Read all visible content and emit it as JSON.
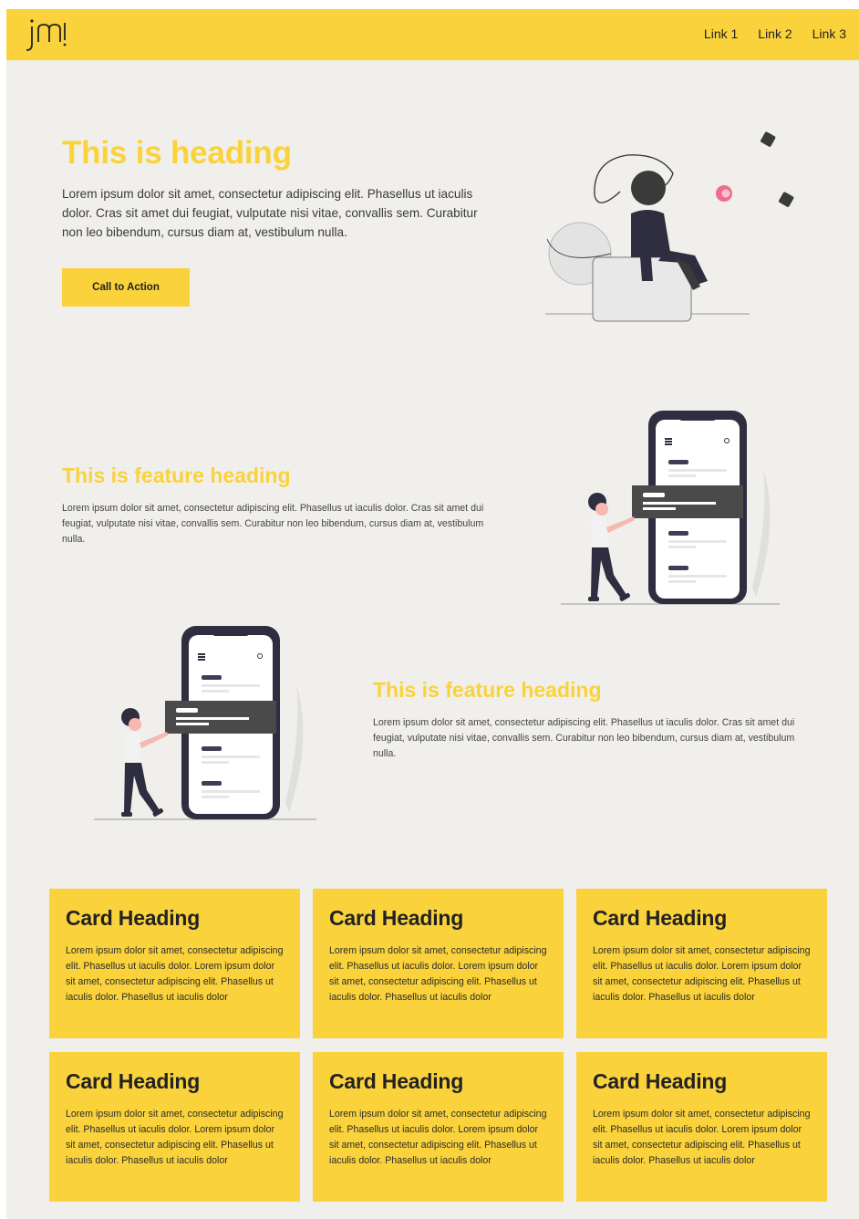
{
  "header": {
    "logo_text": "jm",
    "nav": [
      "Link 1",
      "Link 2",
      "Link 3"
    ]
  },
  "hero": {
    "title": "This is heading",
    "text": "Lorem ipsum dolor sit amet, consectetur adipiscing elit. Phasellus ut iaculis dolor. Cras sit amet dui feugiat, vulputate nisi vitae, convallis sem. Curabitur non leo bibendum, cursus diam at, vestibulum nulla.",
    "cta_label": "Call to Action"
  },
  "features": [
    {
      "title": "This is feature heading",
      "text": "Lorem ipsum dolor sit amet, consectetur adipiscing elit. Phasellus ut iaculis dolor. Cras sit amet dui feugiat, vulputate nisi vitae, convallis sem. Curabitur non leo bibendum, cursus diam at, vestibulum nulla."
    },
    {
      "title": "This is feature heading",
      "text": "Lorem ipsum dolor sit amet, consectetur adipiscing elit. Phasellus ut iaculis dolor. Cras sit amet dui feugiat, vulputate nisi vitae, convallis sem. Curabitur non leo bibendum, cursus diam at, vestibulum nulla."
    }
  ],
  "cards": [
    {
      "heading": "Card Heading",
      "text": "Lorem ipsum dolor sit amet, consectetur adipiscing elit. Phasellus ut iaculis dolor. Lorem ipsum dolor sit amet, consectetur adipiscing elit. Phasellus ut iaculis dolor. Phasellus ut iaculis dolor"
    },
    {
      "heading": "Card Heading",
      "text": "Lorem ipsum dolor sit amet, consectetur adipiscing elit. Phasellus ut iaculis dolor. Lorem ipsum dolor sit amet, consectetur adipiscing elit. Phasellus ut iaculis dolor. Phasellus ut iaculis dolor"
    },
    {
      "heading": "Card Heading",
      "text": "Lorem ipsum dolor sit amet, consectetur adipiscing elit. Phasellus ut iaculis dolor. Lorem ipsum dolor sit amet, consectetur adipiscing elit. Phasellus ut iaculis dolor. Phasellus ut iaculis dolor"
    },
    {
      "heading": "Card Heading",
      "text": "Lorem ipsum dolor sit amet, consectetur adipiscing elit. Phasellus ut iaculis dolor. Lorem ipsum dolor sit amet, consectetur adipiscing elit. Phasellus ut iaculis dolor. Phasellus ut iaculis dolor"
    },
    {
      "heading": "Card Heading",
      "text": "Lorem ipsum dolor sit amet, consectetur adipiscing elit. Phasellus ut iaculis dolor. Lorem ipsum dolor sit amet, consectetur adipiscing elit. Phasellus ut iaculis dolor. Phasellus ut iaculis dolor"
    },
    {
      "heading": "Card Heading",
      "text": "Lorem ipsum dolor sit amet, consectetur adipiscing elit. Phasellus ut iaculis dolor. Lorem ipsum dolor sit amet, consectetur adipiscing elit. Phasellus ut iaculis dolor. Phasellus ut iaculis dolor"
    }
  ],
  "colors": {
    "accent": "#fad23c",
    "background": "#f0efeb",
    "dark": "#2f2e41"
  }
}
